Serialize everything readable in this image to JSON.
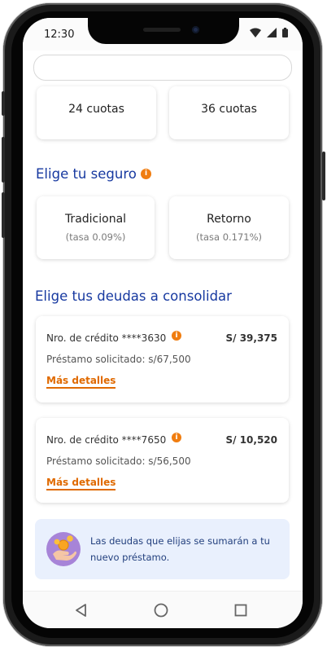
{
  "status_bar": {
    "time": "12:30"
  },
  "installments": {
    "options": [
      "24 cuotas",
      "36 cuotas"
    ]
  },
  "insurance": {
    "title": "Elige tu seguro",
    "options": [
      {
        "name": "Tradicional",
        "rate": "(tasa 0.09%)"
      },
      {
        "name": "Retorno",
        "rate": "(tasa 0.171%)"
      }
    ]
  },
  "debts": {
    "title": "Elige tus deudas a consolidar",
    "items": [
      {
        "credit": "Nro. de crédito ****3630",
        "amount": "S/ 39,375",
        "requested": "Préstamo solicitado: s/67,500",
        "details_link": "Más detalles"
      },
      {
        "credit": "Nro. de crédito ****7650",
        "amount": "S/ 10,520",
        "requested": "Préstamo solicitado: s/56,500",
        "details_link": "Más detalles"
      }
    ]
  },
  "notice": {
    "text": "Las deudas que elijas se sumarán a tu nuevo préstamo."
  },
  "colors": {
    "primary": "#1739a0",
    "accent": "#f07d10",
    "notice_bg": "#e9f0fd"
  },
  "icons": {
    "info": "info-icon",
    "notice": "hand-coin-icon",
    "nav": [
      "back-triangle-icon",
      "home-circle-icon",
      "recents-square-icon"
    ]
  }
}
